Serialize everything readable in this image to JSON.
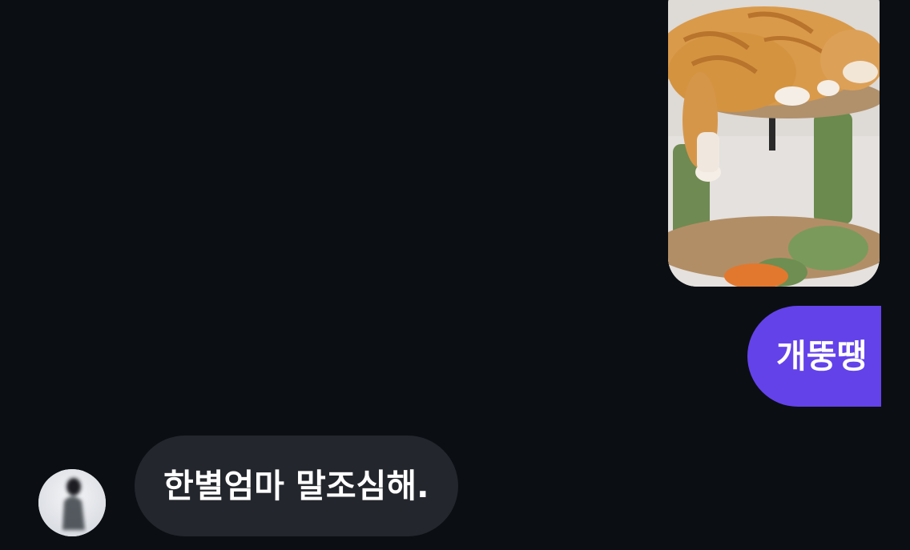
{
  "messages": [
    {
      "type": "image",
      "direction": "outgoing",
      "content": "photo-of-orange-cat-sleeping-on-cat-tree"
    },
    {
      "type": "text",
      "direction": "outgoing",
      "text": "개뚱땡"
    },
    {
      "type": "text",
      "direction": "incoming",
      "text": "한별엄마 말조심해."
    }
  ],
  "colors": {
    "background": "#0b0e13",
    "outgoing_bubble": "#6342ea",
    "incoming_bubble": "#23262c",
    "text": "#ffffff"
  },
  "icons": {
    "avatar": "person-avatar-image"
  }
}
